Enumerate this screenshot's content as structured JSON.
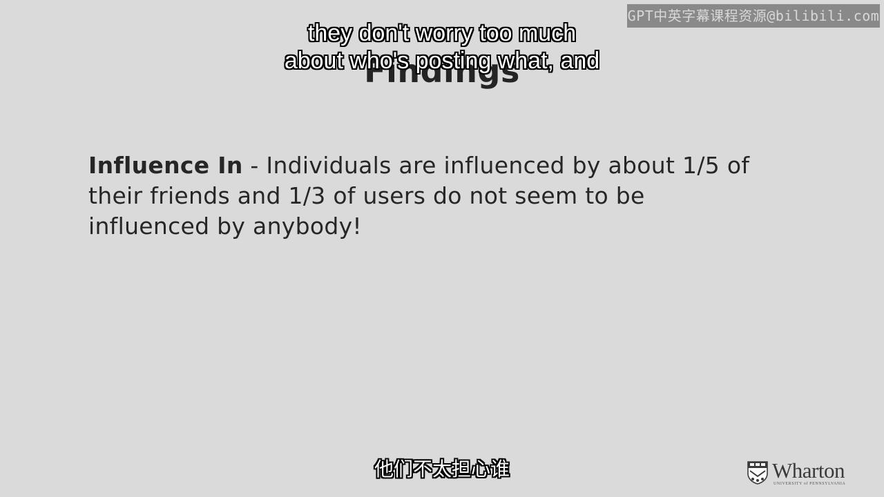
{
  "slide": {
    "title": "Findings",
    "term": "Influence In",
    "separator": " - ",
    "body": "Individuals are influenced by about 1/5 of their friends and 1/3 of users do not seem to be influenced by anybody!"
  },
  "subtitles": {
    "english_lines": [
      "they don't worry too much",
      "about who's posting what, and"
    ],
    "chinese": "他们不太担心谁"
  },
  "watermark": {
    "text": "GPT中英字幕课程资源@bilibili.com"
  },
  "logo": {
    "name": "Wharton",
    "subtext": "UNIVERSITY of PENNSYLVANIA",
    "icon": "shield-icon"
  },
  "colors": {
    "background": "#dadada",
    "text": "#262626",
    "subtitle_fill": "#ffffff",
    "subtitle_outline": "#000000"
  }
}
